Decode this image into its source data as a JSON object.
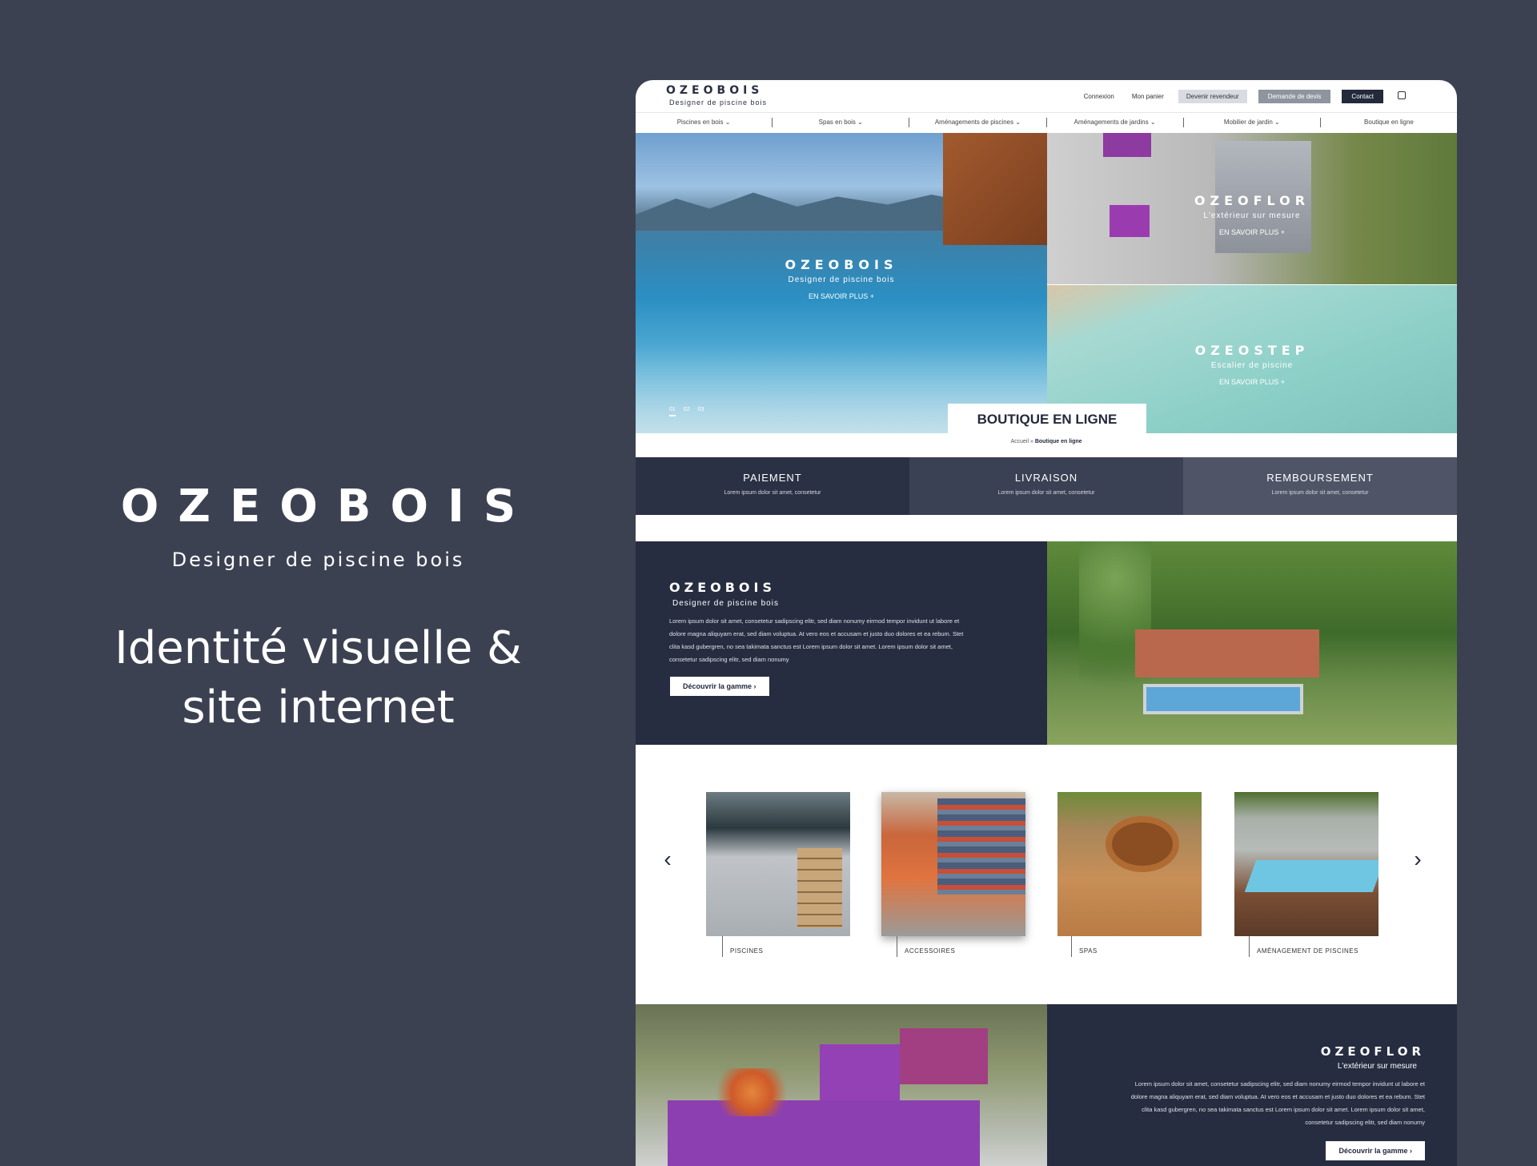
{
  "brand": {
    "logo": "OZEOBOIS",
    "tagline": "Designer de piscine bois",
    "title_line1": "Identité visuelle &",
    "title_line2": "site internet"
  },
  "site": {
    "logo": "OZEOBOIS",
    "tagline": "Designer de piscine bois",
    "top_links": {
      "login": "Connexion",
      "cart": "Mon panier",
      "reseller": "Devenir revendeur",
      "quote": "Demande de devis",
      "contact": "Contact"
    },
    "nav": [
      {
        "label": "Piscines en bois ⌄"
      },
      {
        "label": "Spas en bois ⌄"
      },
      {
        "label": "Aménagements de piscines ⌄"
      },
      {
        "label": "Aménagements de jardins ⌄"
      },
      {
        "label": "Mobilier de jardin ⌄"
      },
      {
        "label": "Boutique en ligne"
      }
    ]
  },
  "hero": {
    "main": {
      "title": "OZEOBOIS",
      "subtitle": "Designer de piscine bois",
      "more": "EN SAVOIR PLUS  +"
    },
    "top_right": {
      "title": "OZEOFLOR",
      "subtitle": "L'extérieur sur mesure",
      "more": "EN SAVOIR PLUS  +"
    },
    "bottom_right": {
      "title": "OZEOSTEP",
      "subtitle": "Escalier de piscine",
      "more": "EN SAVOIR PLUS  +"
    },
    "slides": [
      "01",
      "02",
      "03"
    ],
    "boutique": "BOUTIQUE EN LIGNE",
    "crumb_home": "Accueil »",
    "crumb_current": "Boutique en ligne"
  },
  "features": [
    {
      "title": "PAIEMENT",
      "text": "Lorem ipsum dolor sit amet, consetetur"
    },
    {
      "title": "LIVRAISON",
      "text": "Lorem ipsum dolor sit amet, consetetur"
    },
    {
      "title": "REMBOURSEMENT",
      "text": "Lorem ipsum dolor sit amet, consetetur"
    }
  ],
  "about": {
    "title": "OZEOBOIS",
    "subtitle": "Designer de piscine bois",
    "text": "Lorem ipsum dolor sit amet, consetetur sadipscing elitr, sed diam nonumy eirmod tempor invidunt ut labore et dolore magna aliquyam erat, sed diam voluptua. At vero eos et accusam et justo duo dolores et ea rebum. Stet clita kasd gubergren, no sea takimata sanctus est Lorem ipsum dolor sit amet. Lorem ipsum dolor sit amet, consetetur sadipscing elitr, sed diam nonumy",
    "button": "Découvrir la gamme  ›"
  },
  "carousel": {
    "prev": "‹",
    "next": "›",
    "items": [
      {
        "label": "PISCINES"
      },
      {
        "label": "ACCESSOIRES"
      },
      {
        "label": "SPAS"
      },
      {
        "label": "AMÉNAGEMENT DE PISCINES"
      }
    ]
  },
  "ozeoflor": {
    "title": "OZEOFLOR",
    "subtitle": "L'extérieur sur mesure",
    "text": "Lorem ipsum dolor sit amet, consetetur sadipscing elitr, sed diam nonumy eirmod tempor invidunt ut labore et dolore magna aliquyam erat, sed diam voluptua. At vero eos et accusam et justo duo dolores et ea rebum. Stet clita kasd gubergren, no sea takimata sanctus est Lorem ipsum dolor sit amet. Lorem ipsum dolor sit amet, consetetur sadipscing elitr, sed diam nonumy",
    "button": "Découvrir la gamme  ›"
  }
}
